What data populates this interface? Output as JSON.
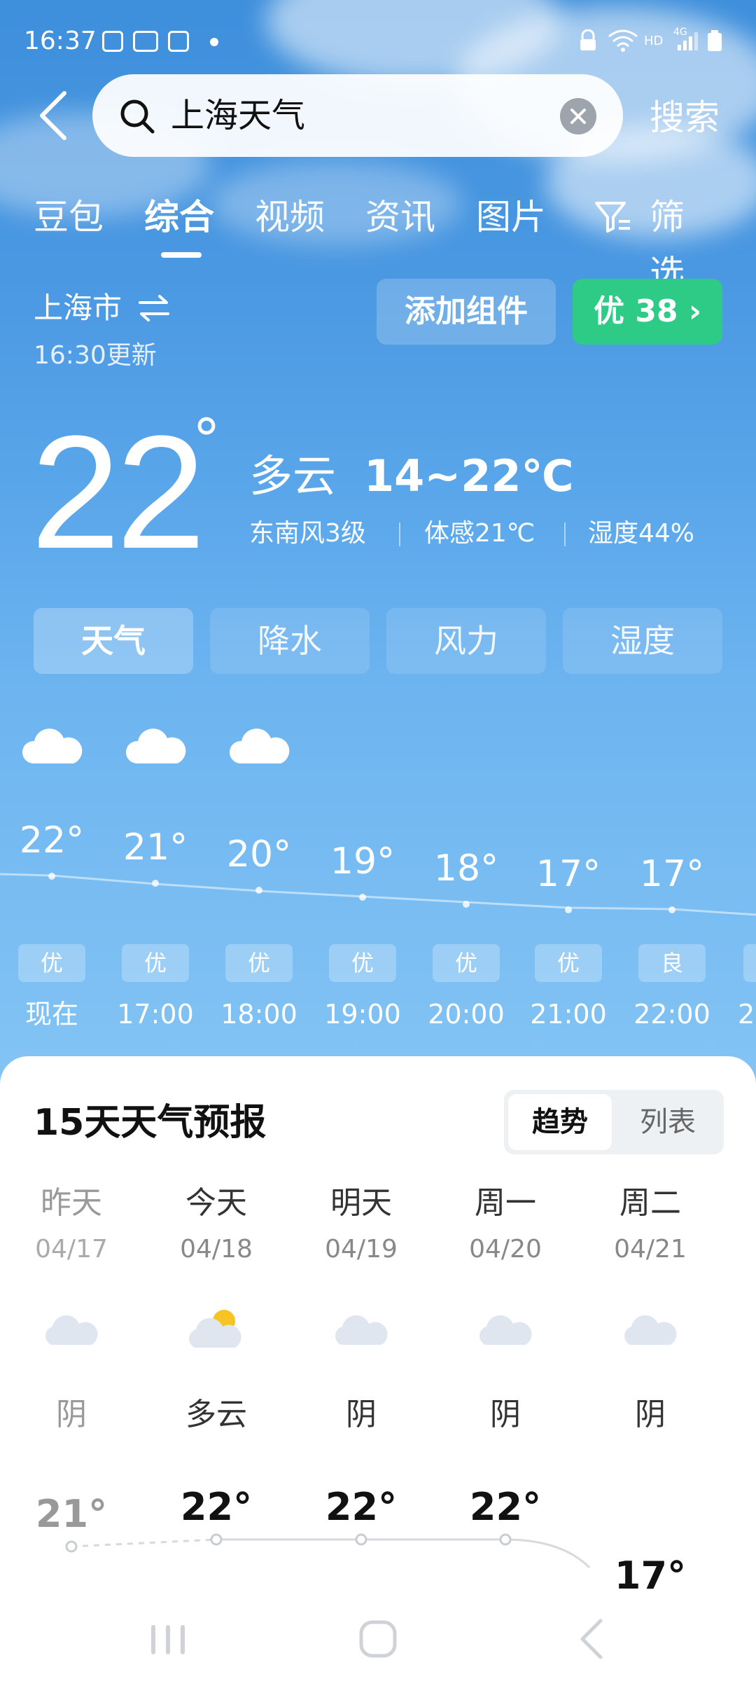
{
  "status_bar": {
    "time": "16:37",
    "network": "HD",
    "signal": "4G"
  },
  "search": {
    "query": "上海天气",
    "button_label": "搜索"
  },
  "tabs": [
    {
      "label": "豆包"
    },
    {
      "label": "综合"
    },
    {
      "label": "视频"
    },
    {
      "label": "资讯"
    },
    {
      "label": "图片"
    },
    {
      "label": "筛选"
    }
  ],
  "active_tab": "综合",
  "location": {
    "city": "上海市",
    "updated": "16:30更新"
  },
  "add_widget_label": "添加组件",
  "aqi": {
    "label": "优 38 ›"
  },
  "current": {
    "temp": "22",
    "deg": "°",
    "condition": "多云",
    "range": "14~22℃",
    "wind": "东南风3级",
    "feels": "体感21℃",
    "humidity": "湿度44%"
  },
  "metric_tabs": [
    {
      "label": "天气"
    },
    {
      "label": "降水"
    },
    {
      "label": "风力"
    },
    {
      "label": "湿度"
    }
  ],
  "hourly": [
    {
      "time": "现在",
      "temp": "22°",
      "icon": "cloud-icon",
      "aqi": "优"
    },
    {
      "time": "17:00",
      "temp": "21°",
      "icon": "cloud-icon",
      "aqi": "优"
    },
    {
      "time": "18:00",
      "temp": "20°",
      "icon": "cloud-icon",
      "aqi": "优"
    },
    {
      "time": "19:00",
      "temp": "19°",
      "icon": "moon-icon",
      "aqi": "优"
    },
    {
      "time": "20:00",
      "temp": "18°",
      "icon": "moon-icon",
      "aqi": "优"
    },
    {
      "time": "21:00",
      "temp": "17°",
      "icon": "moon-icon",
      "aqi": "优"
    },
    {
      "time": "22:00",
      "temp": "17°",
      "icon": "moon-icon",
      "aqi": "良"
    }
  ],
  "forecast": {
    "title": "15天天气预报",
    "views": [
      {
        "label": "趋势"
      },
      {
        "label": "列表"
      }
    ],
    "days": [
      {
        "name": "昨天",
        "date": "04/17",
        "condition": "阴",
        "icon": "overcast-icon",
        "high": "21°"
      },
      {
        "name": "今天",
        "date": "04/18",
        "condition": "多云",
        "icon": "partly-cloudy-icon",
        "high": "22°"
      },
      {
        "name": "明天",
        "date": "04/19",
        "condition": "阴",
        "icon": "overcast-icon",
        "high": "22°"
      },
      {
        "name": "周一",
        "date": "04/20",
        "condition": "阴",
        "icon": "overcast-icon",
        "high": "22°"
      },
      {
        "name": "周二",
        "date": "04/21",
        "condition": "阴",
        "icon": "overcast-icon",
        "high": "17°"
      }
    ]
  },
  "colors": {
    "sky_top": "#3e8fdc",
    "sky_bottom": "#84c4f4",
    "aqi_green": "#2ecb86"
  }
}
